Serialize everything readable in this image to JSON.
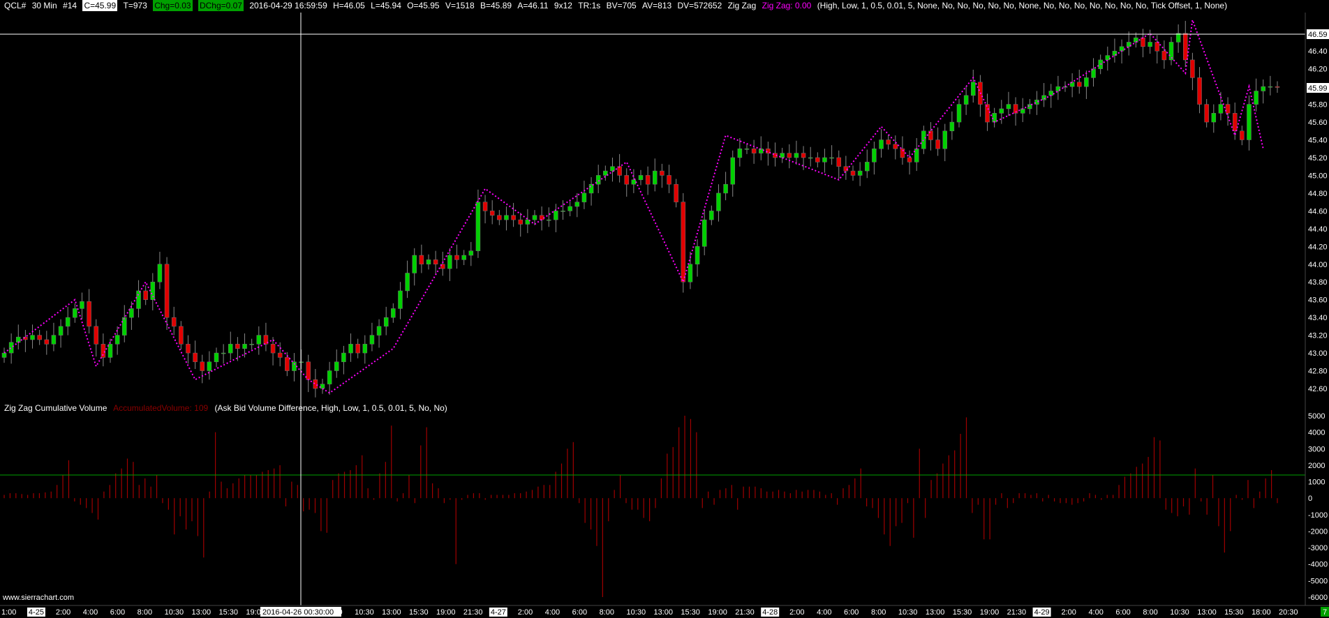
{
  "header": {
    "symbol": "QCL#",
    "timeframe": "30 Min",
    "chart_number": "#14",
    "close": "C=45.99",
    "trades": "T=973",
    "change": "Chg=0.03",
    "daily_change": "DChg=0.07",
    "datetime": "2016-04-29 16:59:59",
    "high": "H=46.05",
    "low": "L=45.94",
    "open": "O=45.95",
    "volume": "V=1518",
    "bid": "B=45.89",
    "ask": "A=46.11",
    "size": "9x12",
    "tr": "TR:1s",
    "bid_volume": "BV=705",
    "ask_volume": "AV=813",
    "dv": "DV=572652",
    "study_name": "Zig Zag",
    "study_value": "Zig Zag: 0.00",
    "study_params": "(High, Low, 1, 0.5, 0.01, 5, None, No, No, No, No, No, None, No, No, No, No, No, No, No, Tick Offset, 1, None)"
  },
  "subgraph": {
    "title": "Zig Zag Cumulative Volume",
    "value": "AccumulatedVolume: 109",
    "params": "(Ask Bid Volume Difference, High, Low, 1, 0.5, 0.01, 5, No, No)"
  },
  "watermark": "www.sierrachart.com",
  "cursor_time_label": "2016-04-26  00:30:00",
  "price_marker": "46.59",
  "last_price_marker": "45.99",
  "bottom_right_badge": "7",
  "colors": {
    "up": "#00d000",
    "down": "#e00000",
    "zigzag": "#ff00ff",
    "volume": "#a00000",
    "zero": "#00a000",
    "bg": "#000000"
  },
  "chart_data": {
    "type": "candlestick",
    "price_axis": {
      "min": 42.6,
      "max": 46.6,
      "ticks": [
        "46.59",
        "46.40",
        "46.20",
        "46.00",
        "45.80",
        "45.60",
        "45.40",
        "45.20",
        "45.00",
        "44.80",
        "44.60",
        "44.40",
        "44.20",
        "44.00",
        "43.80",
        "43.60",
        "43.40",
        "43.20",
        "43.00",
        "42.80",
        "42.60"
      ]
    },
    "volume_axis": {
      "min": -6000,
      "max": 5000,
      "ticks": [
        "5000",
        "4000",
        "3000",
        "2000",
        "1000",
        "0",
        "-1000",
        "-2000",
        "-3000",
        "-4000",
        "-5000",
        "-6000"
      ]
    },
    "time_axis": [
      "1:00",
      "4-25",
      "2:00",
      "4:00",
      "6:00",
      "8:00",
      "10:30",
      "13:00",
      "15:30",
      "19:00",
      "2016-04-26  00:30:00",
      "6:00",
      "8:00",
      "10:30",
      "13:00",
      "15:30",
      "19:00",
      "21:30",
      "4-27",
      "2:00",
      "4:00",
      "6:00",
      "8:00",
      "10:30",
      "13:00",
      "15:30",
      "19:00",
      "21:30",
      "4-28",
      "2:00",
      "4:00",
      "6:00",
      "8:00",
      "10:30",
      "13:00",
      "15:30",
      "19:00",
      "21:30",
      "4-29",
      "2:00",
      "4:00",
      "6:00",
      "8:00",
      "10:30",
      "13:00",
      "15:30",
      "18:00",
      "20:30"
    ],
    "zigzag_points": [
      [
        0,
        43.0
      ],
      [
        10,
        43.6
      ],
      [
        13,
        42.85
      ],
      [
        20,
        43.8
      ],
      [
        27,
        42.7
      ],
      [
        38,
        43.15
      ],
      [
        43,
        42.7
      ],
      [
        46,
        42.55
      ],
      [
        55,
        43.05
      ],
      [
        68,
        44.85
      ],
      [
        75,
        44.45
      ],
      [
        88,
        45.15
      ],
      [
        96,
        43.8
      ],
      [
        102,
        45.45
      ],
      [
        118,
        44.95
      ],
      [
        124,
        45.55
      ],
      [
        128,
        45.2
      ],
      [
        137,
        46.1
      ],
      [
        140,
        45.6
      ],
      [
        148,
        45.9
      ],
      [
        162,
        46.6
      ],
      [
        167,
        46.15
      ],
      [
        168,
        46.75
      ],
      [
        174,
        45.45
      ],
      [
        176,
        46.0
      ],
      [
        178,
        45.3
      ]
    ],
    "closes": [
      43.0,
      43.12,
      43.18,
      43.15,
      43.2,
      43.15,
      43.1,
      43.2,
      43.3,
      43.4,
      43.5,
      43.58,
      43.3,
      43.1,
      42.95,
      43.1,
      43.2,
      43.4,
      43.5,
      43.7,
      43.6,
      43.8,
      44.0,
      43.4,
      43.3,
      43.1,
      43.0,
      42.9,
      42.8,
      42.9,
      43.0,
      43.0,
      43.1,
      43.05,
      43.1,
      43.1,
      43.2,
      43.1,
      43.0,
      42.95,
      42.8,
      42.9,
      42.9,
      42.7,
      42.6,
      42.65,
      42.8,
      42.9,
      43.0,
      43.1,
      43.0,
      43.1,
      43.2,
      43.3,
      43.4,
      43.5,
      43.7,
      43.9,
      44.1,
      44.0,
      44.05,
      44.0,
      43.95,
      44.1,
      44.05,
      44.1,
      44.15,
      44.7,
      44.6,
      44.55,
      44.5,
      44.55,
      44.5,
      44.45,
      44.5,
      44.55,
      44.5,
      44.5,
      44.6,
      44.6,
      44.65,
      44.7,
      44.8,
      44.9,
      45.0,
      45.05,
      45.1,
      45.0,
      44.9,
      44.95,
      45.0,
      44.9,
      45.05,
      45.0,
      44.9,
      44.7,
      43.8,
      44.0,
      44.2,
      44.5,
      44.6,
      44.8,
      44.9,
      45.2,
      45.3,
      45.3,
      45.25,
      45.3,
      45.25,
      45.2,
      45.25,
      45.2,
      45.25,
      45.2,
      45.2,
      45.15,
      45.2,
      45.2,
      45.1,
      45.05,
      45.0,
      45.05,
      45.15,
      45.3,
      45.4,
      45.35,
      45.3,
      45.2,
      45.15,
      45.3,
      45.5,
      45.4,
      45.3,
      45.5,
      45.6,
      45.8,
      45.9,
      46.05,
      45.8,
      45.6,
      45.7,
      45.75,
      45.8,
      45.7,
      45.75,
      45.8,
      45.85,
      45.9,
      45.95,
      46.0,
      46.0,
      46.05,
      46.0,
      46.1,
      46.2,
      46.3,
      46.35,
      46.4,
      46.45,
      46.5,
      46.55,
      46.45,
      46.5,
      46.4,
      46.3,
      46.5,
      46.6,
      46.3,
      46.1,
      45.8,
      45.6,
      45.7,
      45.8,
      45.7,
      45.5,
      45.4,
      45.8,
      45.95,
      46.0,
      46.0,
      45.99
    ],
    "volume_bars": [
      200,
      300,
      300,
      250,
      200,
      300,
      300,
      350,
      400,
      800,
      1400,
      2300,
      -200,
      -400,
      -600,
      -900,
      -1300,
      400,
      800,
      1500,
      1800,
      2400,
      2200,
      800,
      1200,
      700,
      1400,
      -300,
      -700,
      -2200,
      -1100,
      -1900,
      -1400,
      -2300,
      -3600,
      400,
      4000,
      1000,
      600,
      900,
      1200,
      1400,
      1400,
      1400,
      1600,
      1700,
      1800,
      2000,
      -500,
      1000,
      800,
      -800,
      -700,
      -900,
      -2000,
      -2100,
      1100,
      1500,
      1600,
      1700,
      2000,
      2600,
      600,
      -100,
      1500,
      2200,
      4400,
      -200,
      300,
      1400,
      -300,
      3200,
      4300,
      900,
      600,
      -300,
      -100,
      -4000,
      -100,
      200,
      300,
      300,
      -100,
      200,
      200,
      200,
      200,
      300,
      300,
      400,
      500,
      700,
      800,
      800,
      1600,
      2100,
      3000,
      3400,
      -300,
      -1500,
      -1900,
      -2900,
      -6000,
      -1400,
      500,
      1400,
      -300,
      -700,
      -700,
      -1200,
      -1400,
      -600,
      1200,
      2700,
      3100,
      4300,
      5000,
      4800,
      4000,
      -600,
      400,
      -400,
      500,
      600,
      800,
      -700,
      700,
      700,
      700,
      600,
      400,
      400,
      500,
      400,
      300,
      500,
      400,
      500,
      500,
      400,
      200,
      300,
      -400,
      600,
      800,
      1200,
      1800,
      -500,
      -600,
      -1200,
      -2200,
      -2900,
      -1700,
      -1500,
      -300,
      -2400,
      3000,
      -1200,
      1100,
      1500,
      2100,
      2600,
      2900,
      3900,
      4900,
      -900,
      -400,
      -2500,
      -2500,
      -400,
      300,
      -600,
      -300,
      300,
      300,
      200,
      300,
      -200,
      200,
      -200,
      -300,
      -300,
      -400,
      -300,
      -200,
      300,
      200,
      -100,
      200,
      200,
      800,
      1300,
      1500,
      1900,
      2100,
      2500,
      3700,
      3500,
      -700,
      -900,
      -1100,
      -500,
      -1000,
      1800,
      -200,
      -1000,
      1400,
      -1700,
      -3300,
      -2000,
      200,
      -100,
      1100,
      -600,
      400,
      1200,
      1700,
      -300
    ]
  }
}
